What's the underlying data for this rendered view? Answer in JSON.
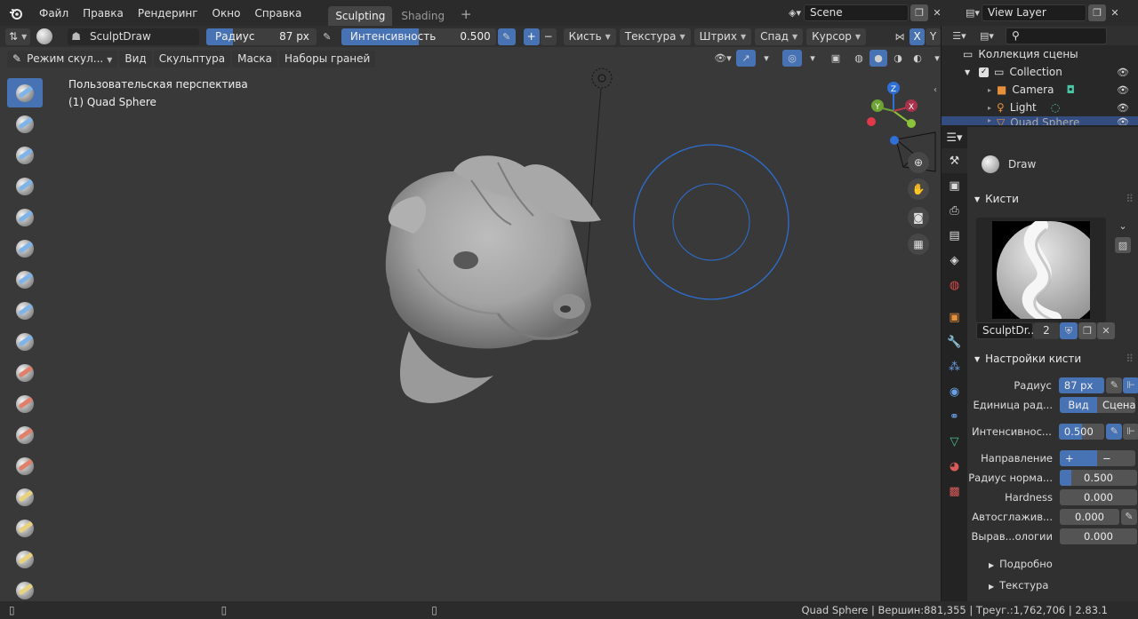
{
  "menu": {
    "items": [
      "Файл",
      "Правка",
      "Рендеринг",
      "Окно",
      "Справка"
    ],
    "workspaces": [
      {
        "label": "Sculpting",
        "active": true
      },
      {
        "label": "Shading",
        "active": false
      }
    ],
    "add_tab": "+"
  },
  "scene": {
    "name": "Scene",
    "view_layer": "View Layer"
  },
  "tool_header": {
    "brush_name": "SculptDraw",
    "radius_label": "Радиус",
    "radius_value": "87 px",
    "strength_label": "Интенсивность",
    "strength_value": "0.500",
    "strength_fraction": 0.5,
    "plus": "+",
    "minus": "−",
    "dropdowns": [
      "Кисть",
      "Текстура",
      "Штрих",
      "Спад",
      "Курсор"
    ],
    "sym_x": "X",
    "sym_y": "Y"
  },
  "mode_header": {
    "mode": "Режим скул...",
    "menus": [
      "Вид",
      "Скульптура",
      "Маска",
      "Наборы граней"
    ]
  },
  "viewport": {
    "view_name": "Пользовательская перспектива",
    "object_label": "(1) Quad Sphere"
  },
  "gizmo": {
    "z": "Z",
    "y": "Y",
    "x": "X"
  },
  "tools": [
    {
      "icon": "draw-brush-icon",
      "color": "#7fb4e8",
      "active": true
    },
    {
      "icon": "draw-sharp-brush-icon",
      "color": "#7fb4e8"
    },
    {
      "icon": "clay-brush-icon",
      "color": "#7fb4e8"
    },
    {
      "icon": "clay-strips-brush-icon",
      "color": "#7fb4e8"
    },
    {
      "icon": "clay-thumb-brush-icon",
      "color": "#7fb4e8"
    },
    {
      "icon": "layer-brush-icon",
      "color": "#7fb4e8"
    },
    {
      "icon": "inflate-brush-icon",
      "color": "#7fb4e8"
    },
    {
      "icon": "blob-brush-icon",
      "color": "#7fb4e8"
    },
    {
      "icon": "crease-brush-icon",
      "color": "#7fb4e8"
    },
    {
      "icon": "smooth-brush-icon",
      "color": "#e0806a"
    },
    {
      "icon": "flatten-brush-icon",
      "color": "#e0806a"
    },
    {
      "icon": "fill-brush-icon",
      "color": "#e0806a"
    },
    {
      "icon": "scrape-brush-icon",
      "color": "#e0806a"
    },
    {
      "icon": "pinch-brush-icon",
      "color": "#e8d27f"
    },
    {
      "icon": "grab-brush-icon",
      "color": "#e8d27f"
    },
    {
      "icon": "snake-hook-brush-icon",
      "color": "#e8d27f"
    },
    {
      "icon": "thumb-brush-icon",
      "color": "#e8d27f"
    }
  ],
  "outliner": {
    "root": "Коллекция сцены",
    "items": [
      {
        "label": "Collection",
        "level": 1
      },
      {
        "label": "Camera",
        "level": 2
      },
      {
        "label": "Light",
        "level": 2
      },
      {
        "label": "Quad Sphere",
        "level": 2
      }
    ]
  },
  "properties": {
    "brush_title": "Draw",
    "brushes_panel": "Кисти",
    "brush_datablock": "SculptDr...",
    "users": "2",
    "settings_panel": "Настройки кисти",
    "rows": {
      "radius_label": "Радиус",
      "radius_value": "87 px",
      "radius_unit_label": "Единица рад...",
      "unit_view": "Вид",
      "unit_scene": "Сцена",
      "strength_label": "Интенсивнос...",
      "strength_value": "0.500",
      "strength_fraction": 0.5,
      "direction_label": "Направление",
      "dir_add": "+ Доб",
      "dir_sub": "− Выч",
      "normal_radius_label": "Радиус норма...",
      "normal_radius_value": "0.500",
      "normal_radius_fraction": 0.15,
      "hardness_label": "Hardness",
      "hardness_value": "0.000",
      "autosmooth_label": "Автосглажив...",
      "autosmooth_value": "0.000",
      "topology_label": "Вырав...ологии",
      "topology_value": "0.000"
    },
    "sub_panels": [
      "Подробно",
      "Текстура"
    ]
  },
  "status": {
    "stats": "Quad Sphere | Вершин:881,355 | Треуг.:1,762,706 | 2.83.1"
  }
}
